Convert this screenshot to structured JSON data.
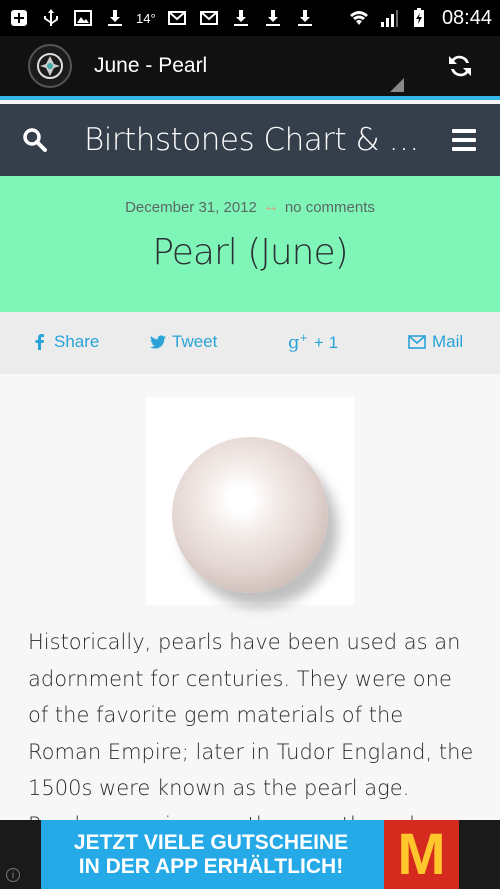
{
  "status_bar": {
    "temperature": "14°",
    "time": "08:44"
  },
  "toolbar": {
    "title": "June - Pearl"
  },
  "site_header": {
    "title": "Birthstones Chart & Me..."
  },
  "post": {
    "date": "December 31, 2012",
    "arrow": "↔",
    "comments": "no comments",
    "title": "Pearl (June)"
  },
  "share": {
    "facebook": "Share",
    "twitter": "Tweet",
    "gplus": "+ 1",
    "mail": "Mail"
  },
  "article": {
    "text": "Historically, pearls have been used as an adornment for centuries. They were one of the favorite gem materials of the Roman Empire; later in Tudor England, the 1500s were known as the pearl age. Pearls are unique as they are the only gems from living"
  },
  "ad": {
    "line1": "JETZT VIELE GUTSCHEINE",
    "line2": "IN DER APP ERHÄLTLICH!",
    "logo": "M",
    "info": "i"
  },
  "colors": {
    "accent": "#33b5e5",
    "header_bg": "#343f4b",
    "post_band": "#7ff5b8",
    "share_blue": "#2aa3d9"
  }
}
